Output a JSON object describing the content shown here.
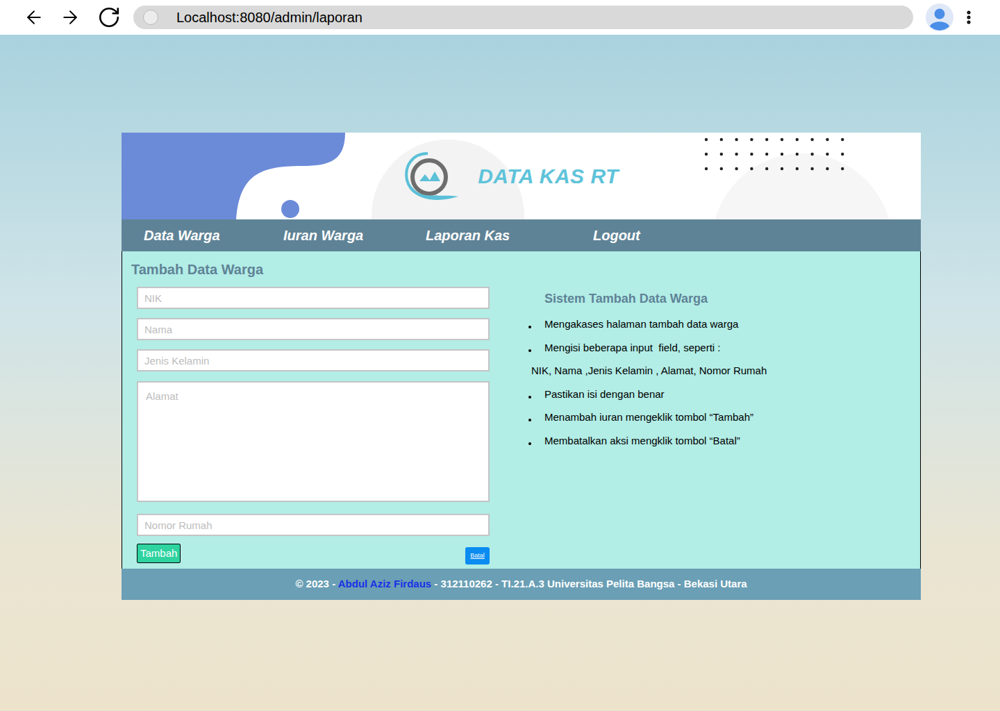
{
  "browser": {
    "url": "Localhost:8080/admin/laporan"
  },
  "header": {
    "title": "DATA KAS RT"
  },
  "nav": [
    {
      "label": "Data Warga"
    },
    {
      "label": "Iuran Warga"
    },
    {
      "label": "Laporan Kas"
    },
    {
      "label": "Logout"
    }
  ],
  "form": {
    "title": "Tambah Data Warga",
    "fields": [
      {
        "placeholder": "NIK",
        "kind": "input"
      },
      {
        "placeholder": "Nama",
        "kind": "input"
      },
      {
        "placeholder": "Jenis Kelamin",
        "kind": "input"
      },
      {
        "placeholder": "Alamat",
        "kind": "textarea"
      },
      {
        "placeholder": "Nomor Rumah",
        "kind": "input"
      }
    ],
    "submit": "Tambah",
    "cancel": "Batal"
  },
  "info": {
    "title": "Sistem Tambah Data Warga",
    "items": [
      {
        "text": "Mengakases halaman tambah data warga",
        "kind": "bullet"
      },
      {
        "text": "Mengisi beberapa input  field, seperti :",
        "kind": "bullet"
      },
      {
        "text": "NIK, Nama ,Jenis Kelamin , Alamat, Nomor Rumah",
        "kind": "plain"
      },
      {
        "text": "Pastikan isi dengan benar",
        "kind": "bullet"
      },
      {
        "text": "Menambah iuran mengeklik tombol “Tambah”",
        "kind": "bullet"
      },
      {
        "text": "Membatalkan aksi mengklik tombol “Batal”",
        "kind": "bullet"
      }
    ]
  },
  "footer": [
    {
      "text": "© 2023 - ",
      "highlight": false
    },
    {
      "text": "Abdul Aziz Firdaus",
      "highlight": true
    },
    {
      "text": " - 312110262 - TI.21.A.3 Universitas Pelita Bangsa - Bekasi Utara",
      "highlight": false
    }
  ]
}
